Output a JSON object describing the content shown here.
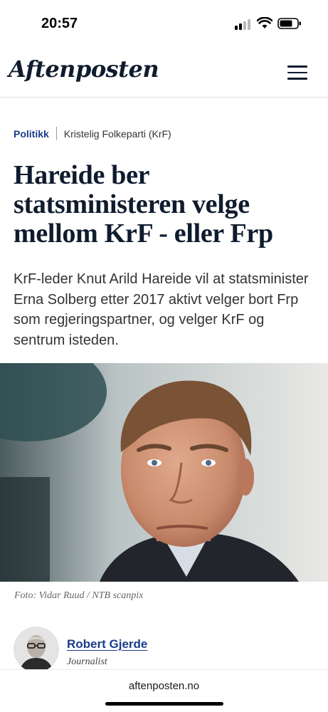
{
  "status_bar": {
    "time": "20:57"
  },
  "header": {
    "logo": "Aftenposten"
  },
  "article": {
    "section": "Politikk",
    "topic": "Kristelig Folkeparti (KrF)",
    "headline": "Hareide ber statsministeren velge mellom KrF - eller Frp",
    "lead": "KrF-leder Knut Arild Hareide vil at statsminister Erna Solberg etter 2017 aktivt velger bort Frp som regjeringspartner, og velger KrF og sentrum isteden.",
    "image_caption": "Foto: Vidar Ruud / NTB scanpix",
    "author": {
      "name": "Robert Gjerde",
      "role": "Journalist"
    }
  },
  "browser": {
    "url": "aftenposten.no"
  },
  "colors": {
    "brand_navy": "#0f1c2e",
    "link_blue": "#1a3c8b"
  }
}
